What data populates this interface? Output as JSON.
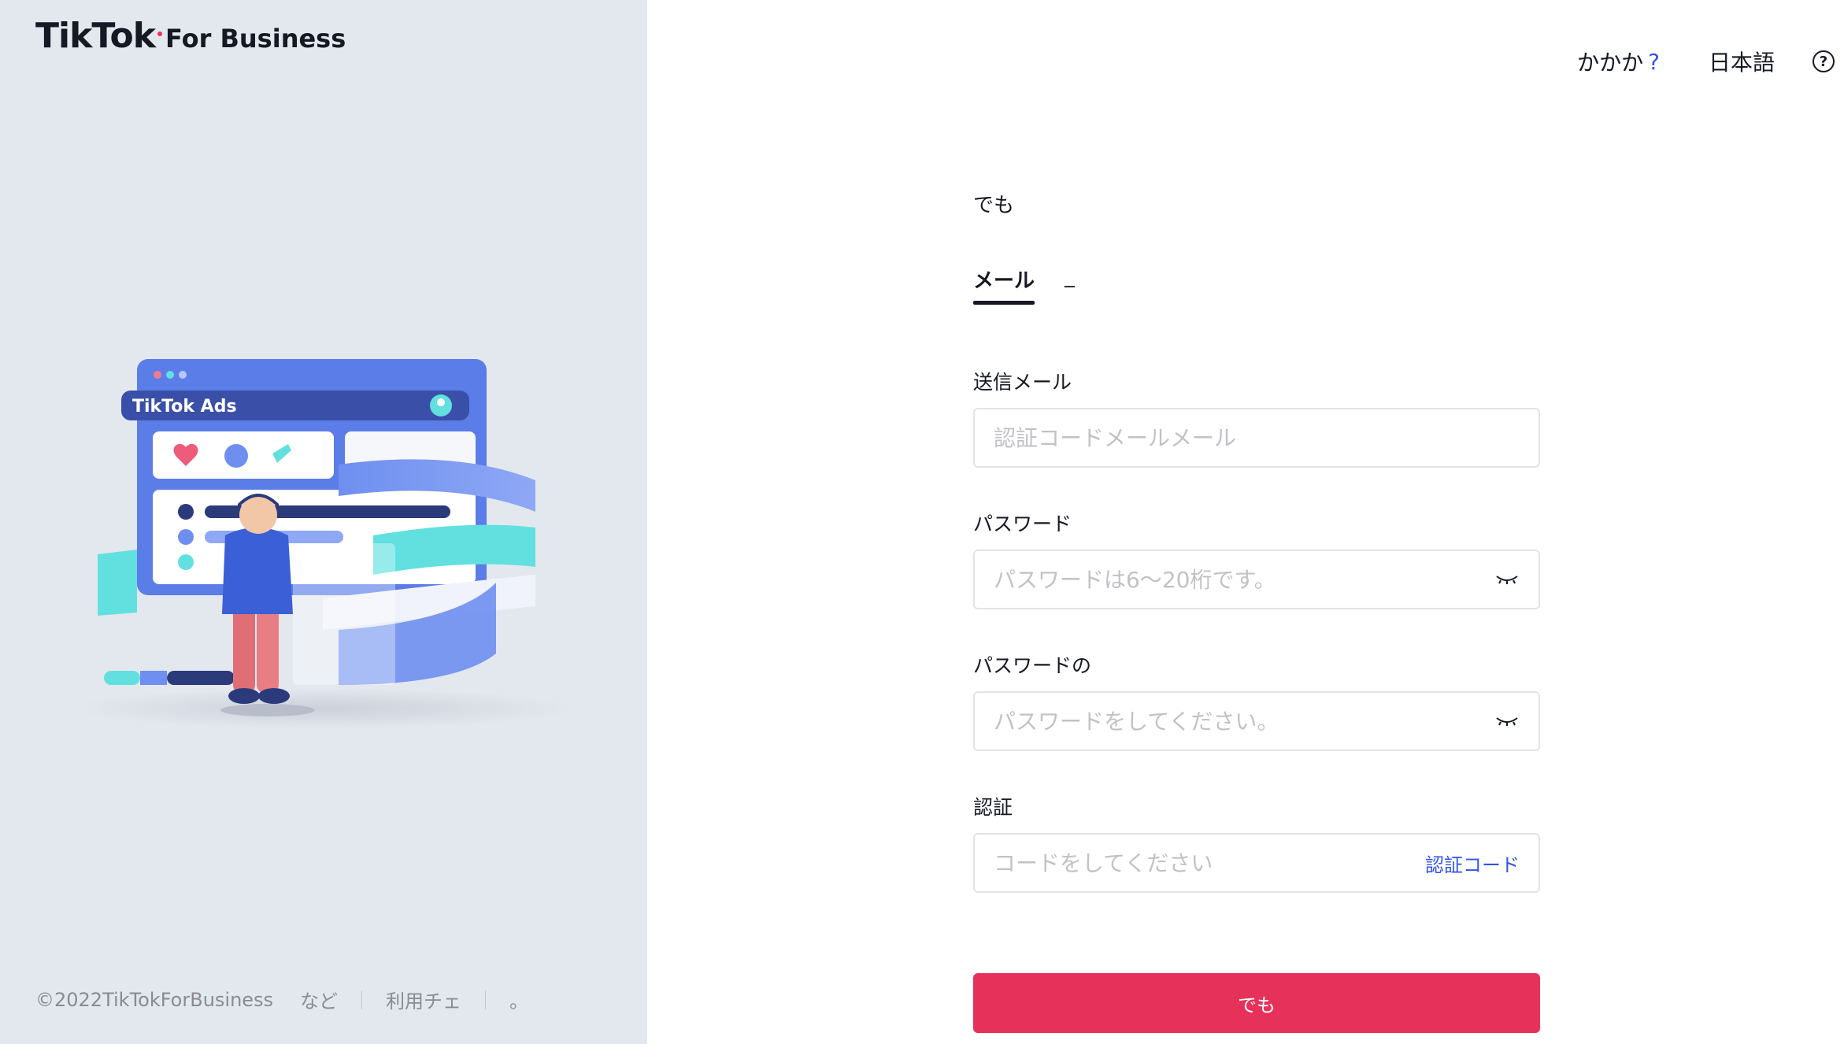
{
  "brand": {
    "name": "TikTok",
    "suffix": "For Business",
    "accent": "#fe2c55"
  },
  "illustration": {
    "window_title": "TikTok Ads"
  },
  "left_footer": {
    "copyright": "©2022TikTokForBusiness",
    "links": [
      "など",
      "利用チェ",
      "。"
    ]
  },
  "header": {
    "help_text": "かかか",
    "help_mark": "?",
    "language": "日本語",
    "help_icon": "question-circle-icon"
  },
  "form": {
    "title": "でも",
    "tabs": [
      {
        "label": "メール",
        "active": true
      },
      {
        "label": "_",
        "active": false
      }
    ],
    "email": {
      "label": "送信メール",
      "value": "",
      "placeholder": "認証コードメールメール"
    },
    "password": {
      "label": "パスワード",
      "value": "",
      "placeholder": "パスワードは6～20桁です。",
      "toggle_icon": "eye-closed-icon"
    },
    "confirm_password": {
      "label": "パスワードの",
      "value": "",
      "placeholder": "パスワードをしてください。",
      "toggle_icon": "eye-closed-icon"
    },
    "verification": {
      "label": "認証",
      "value": "",
      "placeholder": "コードをしてください",
      "send_code_label": "認証コード"
    },
    "submit_label": "でも",
    "submit_color": "#e6325a",
    "link_color": "#2f54eb"
  }
}
